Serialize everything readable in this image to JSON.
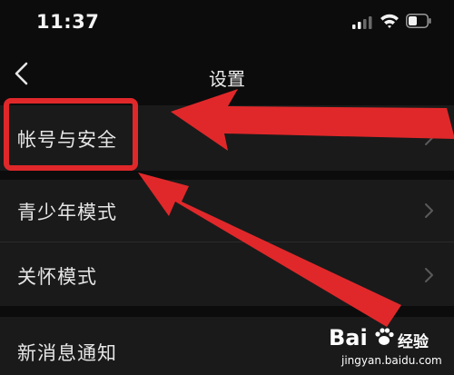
{
  "status_bar": {
    "time": "11:37",
    "icons": [
      "signal-icon",
      "wifi-icon",
      "battery-icon"
    ]
  },
  "nav": {
    "back_icon": "chevron-left-icon",
    "title": "设置"
  },
  "settings_list": {
    "items": [
      {
        "label": "帐号与安全",
        "icon": "chevron-right-icon",
        "highlighted": true
      },
      {
        "label": "青少年模式",
        "icon": "chevron-right-icon"
      },
      {
        "label": "关怀模式",
        "icon": "chevron-right-icon"
      },
      {
        "label": "新消息通知"
      }
    ]
  },
  "annotation": {
    "color": "#e0282a",
    "shapes": [
      "highlight-box",
      "arrow-upper",
      "arrow-lower"
    ]
  },
  "watermark": {
    "logo": "Bai",
    "brand_cn": "经验",
    "url": "jingyan.baidu.com"
  },
  "colors": {
    "background": "#0c0c0c",
    "row_background": "#1a1a1a",
    "text": "#e6e6e6",
    "chevron": "#5a5a5a"
  }
}
